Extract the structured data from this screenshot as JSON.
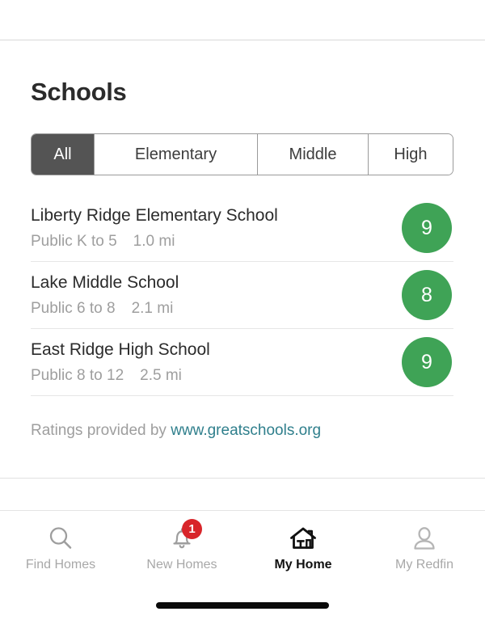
{
  "header": {
    "title": "Schools"
  },
  "filters": {
    "options": [
      {
        "label": "All",
        "selected": true
      },
      {
        "label": "Elementary",
        "selected": false
      },
      {
        "label": "Middle",
        "selected": false
      },
      {
        "label": "High",
        "selected": false
      }
    ]
  },
  "schools": [
    {
      "name": "Liberty Ridge Elementary School",
      "type": "Public K to 5",
      "distance": "1.0 mi",
      "rating": "9"
    },
    {
      "name": "Lake Middle School",
      "type": "Public 6 to 8",
      "distance": "2.1 mi",
      "rating": "8"
    },
    {
      "name": "East Ridge High School",
      "type": "Public 8 to 12",
      "distance": "2.5 mi",
      "rating": "9"
    }
  ],
  "attribution": {
    "prefix": "Ratings provided by ",
    "link_text": "www.greatschools.org"
  },
  "tabbar": {
    "items": [
      {
        "label": "Find Homes",
        "icon": "search-icon",
        "active": false,
        "badge": ""
      },
      {
        "label": "New Homes",
        "icon": "bell-icon",
        "active": false,
        "badge": "1"
      },
      {
        "label": "My Home",
        "icon": "house-icon",
        "active": true,
        "badge": ""
      },
      {
        "label": "My Redfin",
        "icon": "person-icon",
        "active": false,
        "badge": ""
      }
    ]
  },
  "colors": {
    "rating_green": "#3fa356",
    "badge_red": "#d8252a",
    "link_teal": "#2f7f8c",
    "segment_active": "#545454"
  }
}
